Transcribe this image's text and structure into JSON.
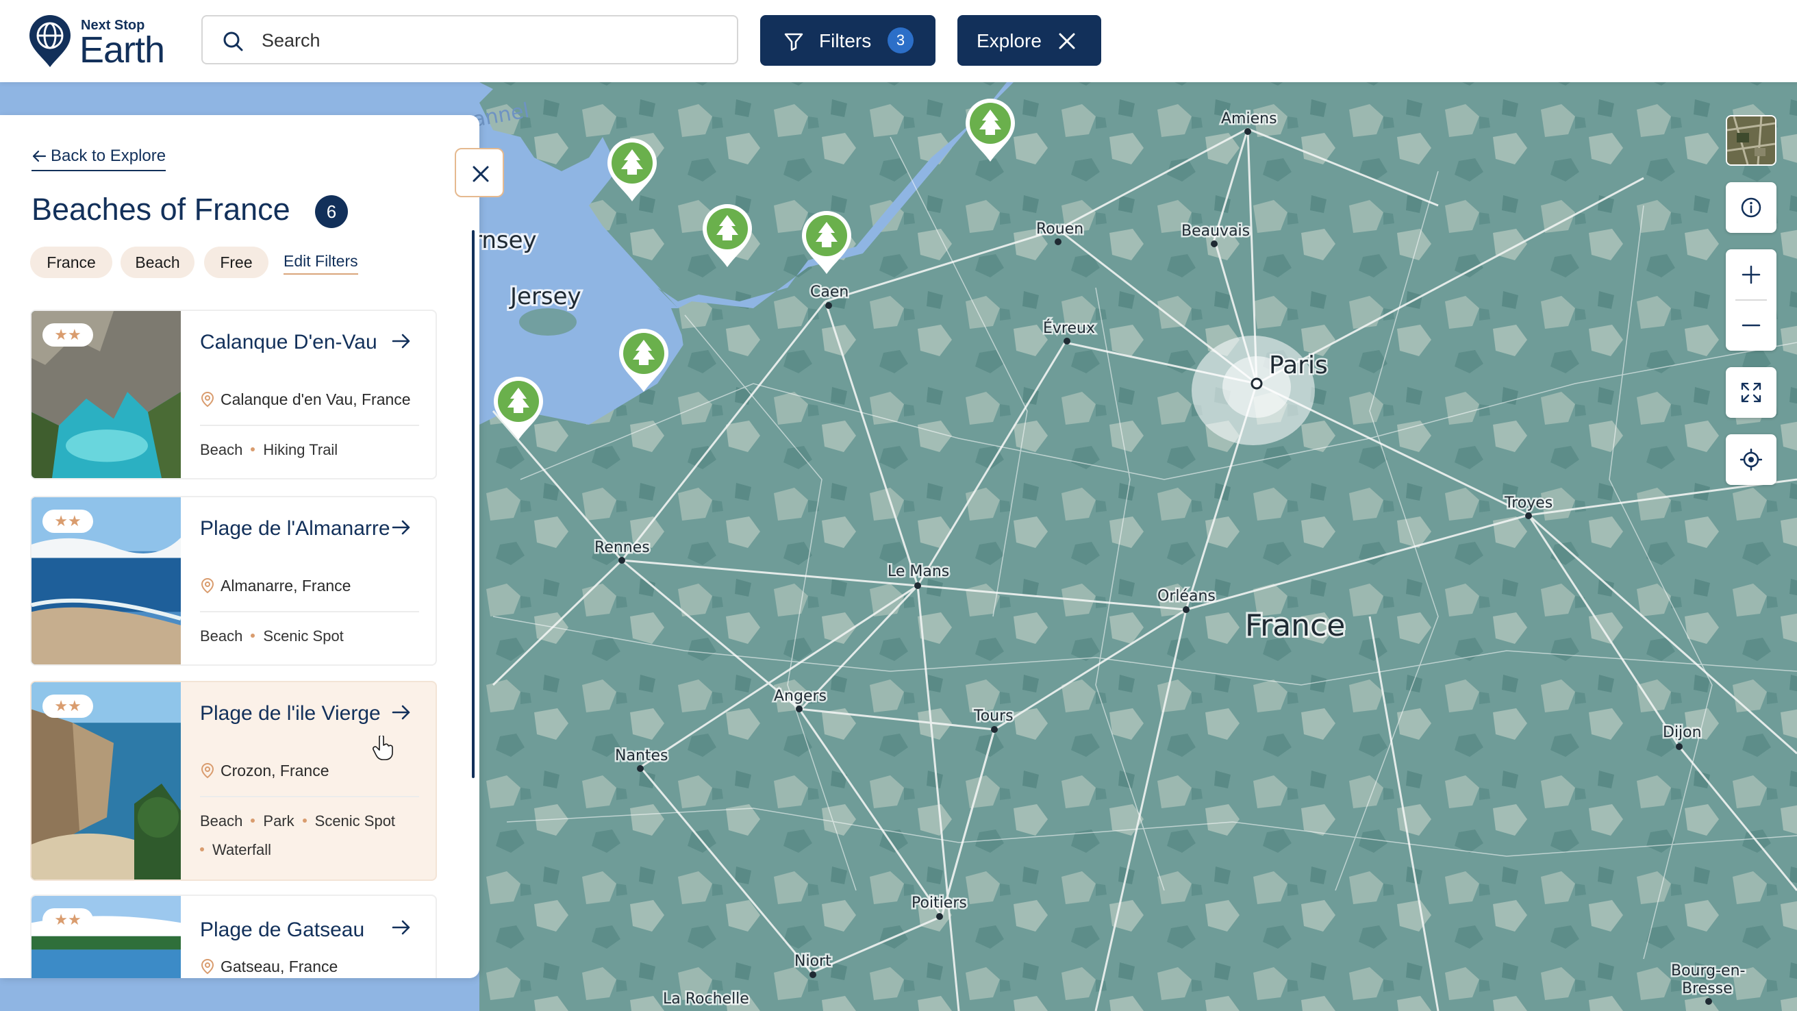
{
  "brand": {
    "tagline": "Next Stop",
    "name": "Earth"
  },
  "search": {
    "placeholder": "Search"
  },
  "filters_button": {
    "label": "Filters",
    "count": "3"
  },
  "explore_button": {
    "label": "Explore"
  },
  "panel": {
    "back_label": "Back to Explore",
    "title": "Beaches of France",
    "count": "6",
    "chips": [
      "France",
      "Beach",
      "Free"
    ],
    "edit_filters": "Edit Filters"
  },
  "cards": [
    {
      "name": "Calanque D'en-Vau",
      "location": "Calanque d'en Vau, France",
      "stars": "★★",
      "tags": [
        "Beach",
        "Hiking Trail"
      ]
    },
    {
      "name": "Plage de l'Almanarre",
      "location": "Almanarre, France",
      "stars": "★★",
      "tags": [
        "Beach",
        "Scenic Spot"
      ]
    },
    {
      "name": "Plage de l'ile Vierge",
      "location": "Crozon, France",
      "stars": "★★",
      "tags": [
        "Beach",
        "Park",
        "Scenic Spot",
        "Waterfall"
      ]
    },
    {
      "name": "Plage de Gatseau",
      "location": "Gatseau, France",
      "stars": "★★",
      "tags": []
    }
  ],
  "map": {
    "cities": [
      "Amiens",
      "Rouen",
      "Beauvais",
      "Caen",
      "Évreux",
      "Paris",
      "Troyes",
      "Rennes",
      "Le Mans",
      "Orléans",
      "Angers",
      "Tours",
      "Nantes",
      "Dijon",
      "Poitiers",
      "Niort",
      "La Rochelle",
      "Bourg-en-",
      "Bresse"
    ],
    "regions": [
      "France",
      "Jersey",
      "rnsey",
      "annel"
    ],
    "marker_icon": "tree-icon",
    "colors": {
      "sea": "#8fb5e3",
      "land": "#6f9c98",
      "marker": "#6ab04c",
      "brand": "#12305a"
    }
  },
  "controls": [
    "satellite-toggle",
    "info-icon",
    "zoom-in-icon",
    "zoom-out-icon",
    "fullscreen-icon",
    "locate-icon"
  ]
}
